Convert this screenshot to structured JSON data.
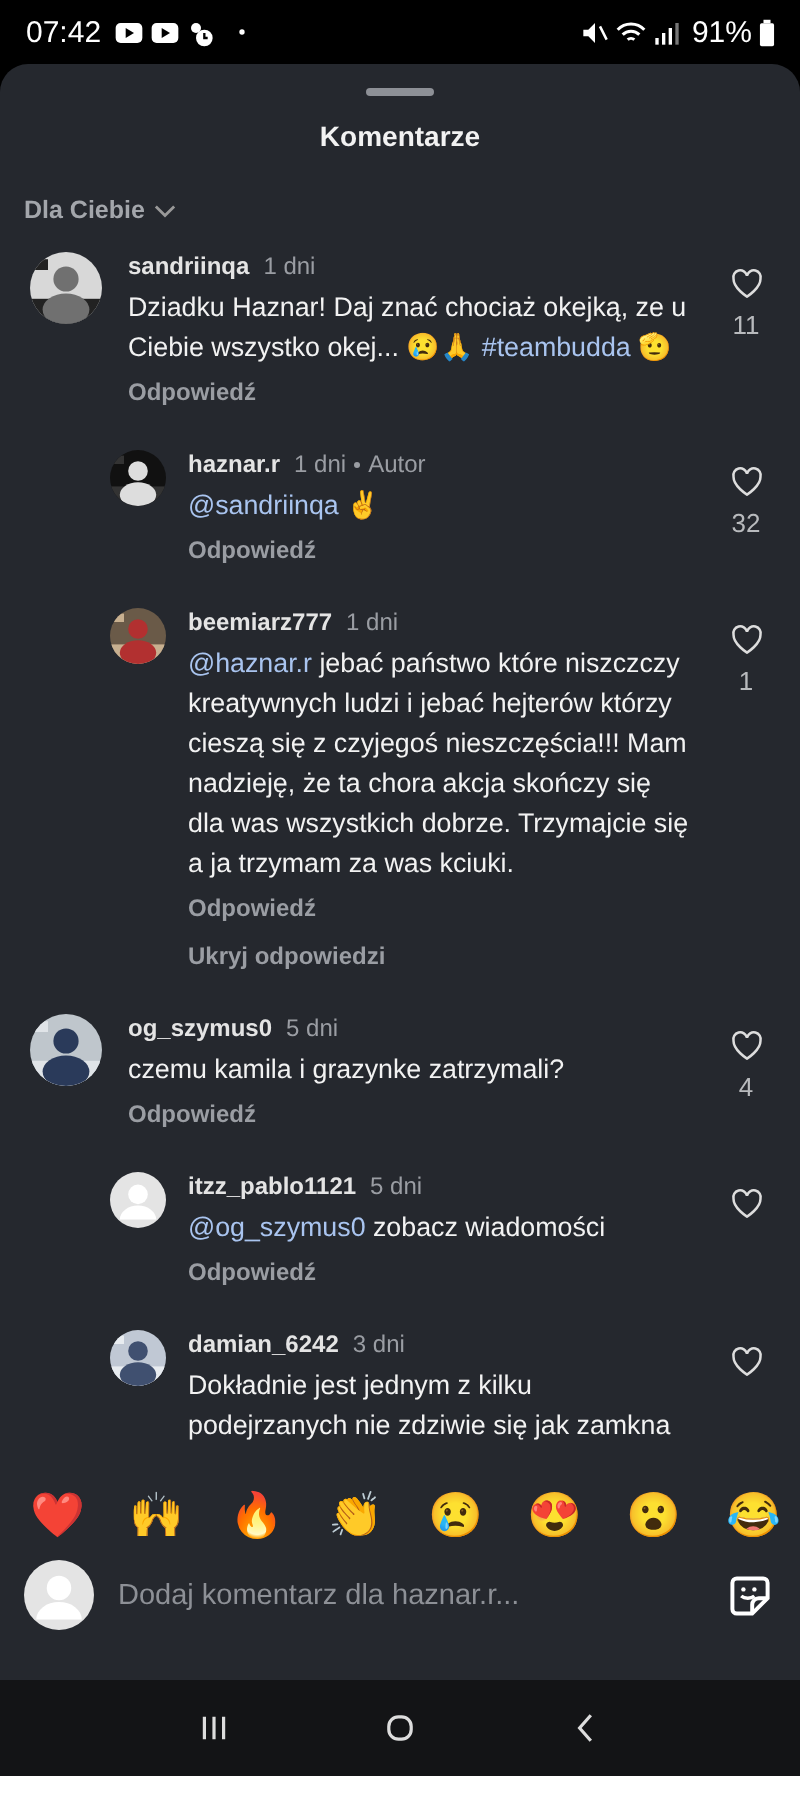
{
  "status_bar": {
    "time": "07:42",
    "battery": "91%"
  },
  "sheet": {
    "title": "Komentarze",
    "sort": "Dla Ciebie"
  },
  "comments": [
    {
      "user": "sandriinqa",
      "age": "1 dni",
      "avatar": {
        "kind": "picture"
      },
      "likes": "11",
      "reply": "Odpowiedź",
      "body": [
        {
          "kind": "text",
          "text": "Dziadku Haznar! Daj znać chociaż okejką, ze u Ciebie wszystko okej... 😢🙏 "
        },
        {
          "kind": "hashtag",
          "text": "#teambudda"
        },
        {
          "kind": "text",
          "text": " 🫡"
        }
      ],
      "children": [
        {
          "user": "haznar.r",
          "age": "1 dni",
          "author": "Autor",
          "avatar": {
            "kind": "picture"
          },
          "likes": "32",
          "reply": "Odpowiedź",
          "body": [
            {
              "kind": "mention",
              "text": "@sandriinqa"
            },
            {
              "kind": "text",
              "text": " ✌"
            }
          ]
        },
        {
          "user": "beemiarz777",
          "age": "1 dni",
          "avatar": {
            "kind": "picture"
          },
          "likes": "1",
          "reply": "Odpowiedź",
          "body": [
            {
              "kind": "mention",
              "text": "@haznar.r"
            },
            {
              "kind": "text",
              "text": " jebać państwo które niszczczy kreatywnych ludzi i jebać hejterów którzy cieszą się z czyjegoś nieszczęścia!!! Mam nadzieję, że ta chora akcja skończy się dla was wszystkich dobrze. Trzymajcie się a ja trzymam za was kciuki."
            }
          ]
        }
      ],
      "toggle": "Ukryj odpowiedzi"
    },
    {
      "user": "og_szymus0",
      "age": "5 dni",
      "avatar": {
        "kind": "picture"
      },
      "likes": "4",
      "reply": "Odpowiedź",
      "body": [
        {
          "kind": "text",
          "text": "czemu kamila i grazynke zatrzymali?"
        }
      ],
      "children": [
        {
          "user": "itzz_pablo1121",
          "age": "5 dni",
          "avatar": {
            "kind": "default"
          },
          "reply": "Odpowiedź",
          "body": [
            {
              "kind": "mention",
              "text": "@og_szymus0"
            },
            {
              "kind": "text",
              "text": " zobacz wiadomości"
            }
          ]
        },
        {
          "user": "damian_6242",
          "age": "3 dni",
          "avatar": {
            "kind": "picture"
          },
          "body": [
            {
              "kind": "text",
              "text": "Dokładnie jest jednym z kilku podejrzanych nie zdziwie się jak zamkna"
            }
          ]
        }
      ]
    }
  ],
  "reactions": [
    "❤️",
    "🙌",
    "🔥",
    "👏",
    "😢",
    "😍",
    "😮",
    "😂"
  ],
  "composer": {
    "placeholder": "Dodaj komentarz dla haznar.r..."
  }
}
